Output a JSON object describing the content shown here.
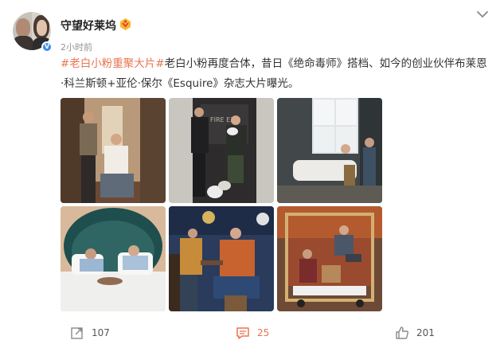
{
  "post": {
    "username": "守望好莱坞",
    "timestamp": "2小时前",
    "hashtag": "#老白小粉重聚大片#",
    "body_text": "老白小粉再度合体，昔日《绝命毒师》搭档、如今的创业伙伴布莱恩·科兰斯顿+亚伦·保尔《Esquire》杂志大片曝光。"
  },
  "images": [
    {
      "icon": "photo-hallway"
    },
    {
      "icon": "photo-doorway-dogs"
    },
    {
      "icon": "photo-bathroom"
    },
    {
      "icon": "photo-bed"
    },
    {
      "icon": "photo-bar"
    },
    {
      "icon": "photo-luggage-cart"
    }
  ],
  "actions": {
    "repost_count": "107",
    "comment_count": "25",
    "like_count": "201"
  },
  "colors": {
    "accent": "#eb7350",
    "verified": "#3a8ce8",
    "meta_gray": "#939393"
  }
}
